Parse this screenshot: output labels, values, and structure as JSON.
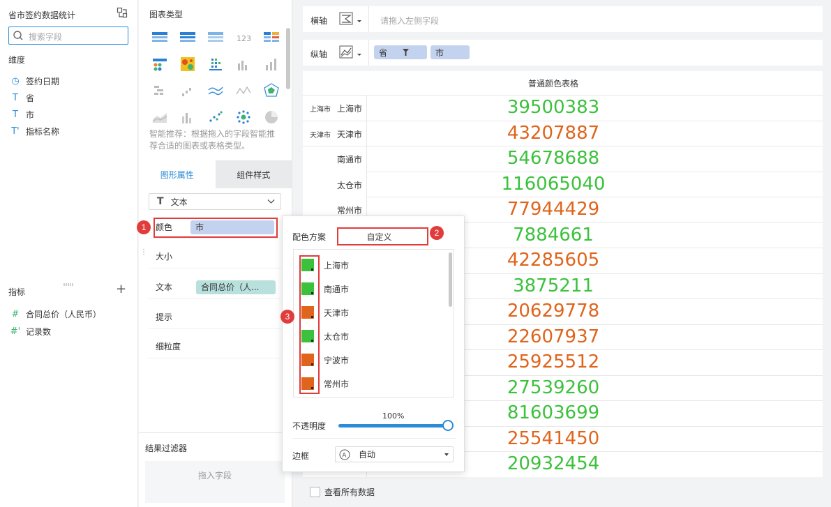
{
  "left_panel": {
    "dataset_title": "省市签约数据统计",
    "search_placeholder": "搜索字段",
    "dimensions_title": "维度",
    "dimensions": [
      {
        "icon": "clock-icon",
        "glyph": "◷",
        "label": "签约日期"
      },
      {
        "icon": "text-type-icon",
        "glyph": "T",
        "label": "省"
      },
      {
        "icon": "text-type-icon",
        "glyph": "T",
        "label": "市"
      },
      {
        "icon": "text-type-icon",
        "glyph": "T'",
        "label": "指标名称"
      }
    ],
    "metrics_title": "指标",
    "add_label": "+",
    "metrics": [
      {
        "icon": "number-type-icon",
        "glyph": "#",
        "label": "合同总价（人民币）"
      },
      {
        "icon": "number-type-icon",
        "glyph": "#'",
        "label": "记录数"
      }
    ]
  },
  "config_panel": {
    "chart_types_title": "图表类型",
    "smart_recommend": "智能推荐：根据拖入的字段智能推荐合适的图表或表格类型。",
    "tabs": [
      "图形属性",
      "组件样式"
    ],
    "mark_type": "文本",
    "properties": {
      "color_label": "颜色",
      "color_field": "市",
      "size_label": "大小",
      "text_label": "文本",
      "text_field": "合同总价（人...",
      "tooltip_label": "提示",
      "granularity_label": "细粒度"
    },
    "filter_title": "结果过滤器",
    "filter_drop": "拖入字段"
  },
  "axes": {
    "x_label": "横轴",
    "x_placeholder": "请拖入左侧字段",
    "y_label": "纵轴",
    "y_fields": [
      "省",
      "市"
    ]
  },
  "table": {
    "title": "普通颜色表格",
    "rows": [
      {
        "prov": "上海市",
        "city": "上海市",
        "value": "39500383",
        "color": "#3cc13c"
      },
      {
        "prov": "天津市",
        "city": "天津市",
        "value": "43207887",
        "color": "#e0641c"
      },
      {
        "prov": "",
        "city": "南通市",
        "value": "54678688",
        "color": "#3cc13c"
      },
      {
        "prov": "",
        "city": "太仓市",
        "value": "116065040",
        "color": "#3cc13c"
      },
      {
        "prov": "",
        "city": "常州市",
        "value": "77944429",
        "color": "#e0641c"
      },
      {
        "prov": "",
        "city": "",
        "value": "7884661",
        "color": "#3cc13c"
      },
      {
        "prov": "",
        "city": "",
        "value": "42285605",
        "color": "#e0641c"
      },
      {
        "prov": "",
        "city": "",
        "value": "3875211",
        "color": "#3cc13c"
      },
      {
        "prov": "",
        "city": "",
        "value": "20629778",
        "color": "#e0641c"
      },
      {
        "prov": "",
        "city": "",
        "value": "22607937",
        "color": "#e0641c"
      },
      {
        "prov": "",
        "city": "",
        "value": "25925512",
        "color": "#e0641c"
      },
      {
        "prov": "",
        "city": "",
        "value": "27539260",
        "color": "#3cc13c"
      },
      {
        "prov": "",
        "city": "",
        "value": "81603699",
        "color": "#3cc13c"
      },
      {
        "prov": "",
        "city": "",
        "value": "25541450",
        "color": "#e0641c"
      },
      {
        "prov": "",
        "city": "",
        "value": "20932454",
        "color": "#3cc13c"
      }
    ],
    "view_all": "查看所有数据"
  },
  "color_popup": {
    "scheme_label": "配色方案",
    "scheme_value": "自定义",
    "items": [
      {
        "name": "上海市",
        "color": "#3cc13c"
      },
      {
        "name": "南通市",
        "color": "#3cc13c"
      },
      {
        "name": "天津市",
        "color": "#e0641c"
      },
      {
        "name": "太仓市",
        "color": "#3cc13c"
      },
      {
        "name": "宁波市",
        "color": "#e0641c"
      },
      {
        "name": "常州市",
        "color": "#e0641c"
      }
    ],
    "opacity_label": "不透明度",
    "opacity_value": "100%",
    "opacity": 1.0,
    "border_label": "边框",
    "border_value": "自动"
  },
  "annotations": [
    "1",
    "2",
    "3"
  ],
  "colors": {
    "accent": "#2b8cd8",
    "green": "#3cc13c",
    "orange": "#e0641c",
    "annotation_red": "#e03c3c"
  }
}
